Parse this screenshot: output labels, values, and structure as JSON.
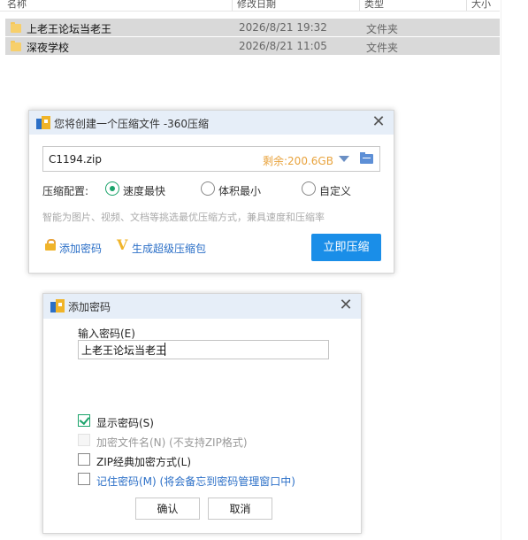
{
  "explorer": {
    "columns": {
      "name": "名称",
      "date": "修改日期",
      "type": "类型",
      "size": "大小"
    },
    "rows": [
      {
        "name": "上老王论坛当老王",
        "date": "2026/8/21 19:32",
        "type": "文件夹",
        "icon": "folder-icon"
      },
      {
        "name": "深夜学校",
        "date": "2026/8/21 11:05",
        "type": "文件夹",
        "icon": "folder-icon"
      }
    ]
  },
  "compress_dialog": {
    "title": "您将创建一个压缩文件 -360压缩",
    "filename": "C1194.zip",
    "free_space": "剩余:200.6GB",
    "config_label": "压缩配置:",
    "options": [
      {
        "label": "速度最快",
        "selected": true
      },
      {
        "label": "体积最小",
        "selected": false
      },
      {
        "label": "自定义",
        "selected": false
      }
    ],
    "hint": "智能为图片、视频、文档等挑选最优压缩方式，兼具速度和压缩率",
    "add_password_link": "添加密码",
    "super_package_link": "生成超级压缩包",
    "compress_button": "立即压缩",
    "accent_color": "#1a8ee8"
  },
  "password_dialog": {
    "title": "添加密码",
    "input_label": "输入密码(E)",
    "password_value": "上老王论坛当老王",
    "checkboxes": [
      {
        "label": "显示密码(S)",
        "checked": true,
        "disabled": false
      },
      {
        "label": "加密文件名(N) (不支持ZIP格式)",
        "checked": false,
        "disabled": true
      },
      {
        "label": "ZIP经典加密方式(L)",
        "checked": false,
        "disabled": false
      },
      {
        "label": "记住密码(M) (将会备忘到密码管理窗口中)",
        "checked": false,
        "disabled": false
      }
    ],
    "ok_button": "确认",
    "cancel_button": "取消"
  }
}
